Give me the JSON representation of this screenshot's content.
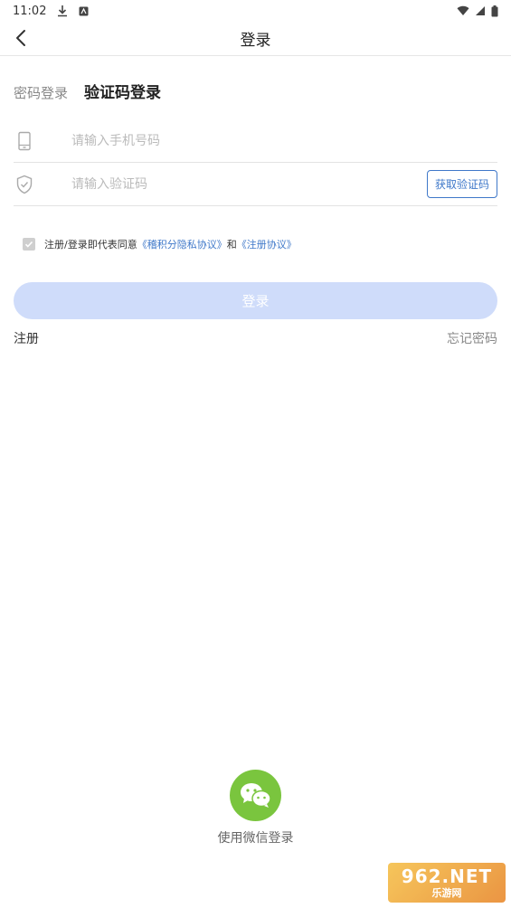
{
  "status_bar": {
    "time": "11:02"
  },
  "header": {
    "title": "登录"
  },
  "tabs": {
    "password_login": "密码登录",
    "code_login": "验证码登录"
  },
  "form": {
    "phone_placeholder": "请输入手机号码",
    "code_placeholder": "请输入验证码",
    "get_code_label": "获取验证码"
  },
  "agreement": {
    "prefix": "注册/登录即代表同意",
    "privacy_link": "《稽积分隐私协议》",
    "and": "和",
    "register_link": "《注册协议》"
  },
  "actions": {
    "login_label": "登录",
    "register_label": "注册",
    "forgot_label": "忘记密码"
  },
  "third_party": {
    "wechat_label": "使用微信登录"
  },
  "watermark": {
    "line1": "962.NET",
    "line2": "乐游网"
  },
  "colors": {
    "accent": "#3f78c9",
    "login_disabled": "#cfdcfa",
    "wechat": "#7ac53e"
  }
}
